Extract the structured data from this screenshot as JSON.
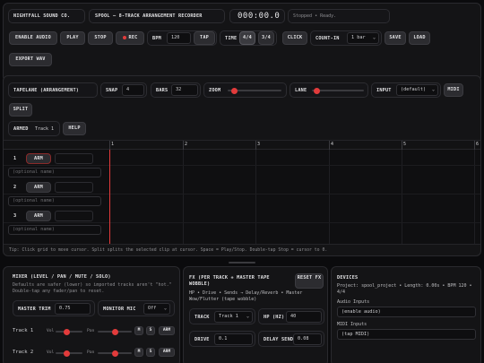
{
  "header": {
    "brand": "NIGHTFALL SOUND CO.",
    "title": "SPOOL — 8-TRACK ARRANGEMENT RECORDER",
    "time": "000:00.0",
    "status": "Stopped • Ready."
  },
  "transport": {
    "enable_audio": "ENABLE AUDIO",
    "play": "PLAY",
    "stop": "STOP",
    "rec": "REC",
    "bpm_label": "BPM",
    "bpm_value": "120",
    "tap": "TAP",
    "time_label": "TIME",
    "time_44": "4/4",
    "time_34": "3/4",
    "click": "CLICK",
    "count_in_label": "COUNT-IN",
    "count_in_value": "1 bar",
    "save": "SAVE",
    "load": "LOAD",
    "export": "EXPORT WAV"
  },
  "tapelane": {
    "title": "TAPELANE (ARRANGEMENT)",
    "snap_label": "SNAP",
    "snap_value": "4",
    "bars_label": "BARS",
    "bars_value": "32",
    "zoom_label": "ZOOM",
    "zoom_level": 0.12,
    "lane_label": "LANE",
    "lane_level": 0.1,
    "input_label": "INPUT",
    "input_value": "(default)",
    "midi": "MIDI",
    "split": "SPLIT",
    "armed_label": "ARMED",
    "armed_value": "Track 1",
    "help": "HELP"
  },
  "ruler": [
    "1",
    "2",
    "3",
    "4",
    "5",
    "6"
  ],
  "tracks": [
    {
      "num": "1",
      "arm": "ARM",
      "name_placeholder": "(optional name)"
    },
    {
      "num": "2",
      "arm": "ARM",
      "name_placeholder": "(optional name)"
    },
    {
      "num": "3",
      "arm": "ARM",
      "name_placeholder": "(optional name)"
    }
  ],
  "tip": "Tip: Click grid to move cursor. Split splits the selected clip at cursor. Space = Play/Stop. Double-tap Stop = cursor to 0.",
  "mixer": {
    "title": "MIXER (LEVEL / PAN / MUTE / SOLO)",
    "desc": "Defaults are safer (lower) so imported tracks aren't \"hot.\" Double-tap any fader/pan to reset.",
    "master_trim_label": "MASTER TRIM",
    "master_trim_value": "0.75",
    "monitor_label": "MONITOR MIC",
    "monitor_value": "Off",
    "rows": [
      {
        "name": "Track 1",
        "vol": "Vol",
        "pan": "Pan",
        "m": "M",
        "s": "S",
        "arm": "ARM",
        "vol_level": 0.4,
        "pan_level": 0.5
      },
      {
        "name": "Track 2",
        "vol": "Vol",
        "pan": "Pan",
        "m": "M",
        "s": "S",
        "arm": "ARM",
        "vol_level": 0.4,
        "pan_level": 0.5
      }
    ]
  },
  "fx": {
    "title": "FX (PER TRACK + MASTER TAPE WOBBLE)",
    "reset": "RESET FX",
    "desc": "HP • Drive • Sends → Delay/Reverb • Master Wow/Flutter (tape wobble)",
    "track_label": "TRACK",
    "track_value": "Track 1",
    "hp_label": "HP (HZ)",
    "hp_value": "40",
    "drive_label": "DRIVE",
    "drive_value": "0.1",
    "delay_label": "DELAY SEND",
    "delay_value": "0.08"
  },
  "devices": {
    "title": "DEVICES",
    "project": "Project: spool_project • Length: 0.00s • BPM 120 • 4/4",
    "audio_label": "Audio Inputs",
    "audio_value": "(enable audio)",
    "midi_label": "MIDI Inputs",
    "midi_value": "(tap MIDI)"
  }
}
